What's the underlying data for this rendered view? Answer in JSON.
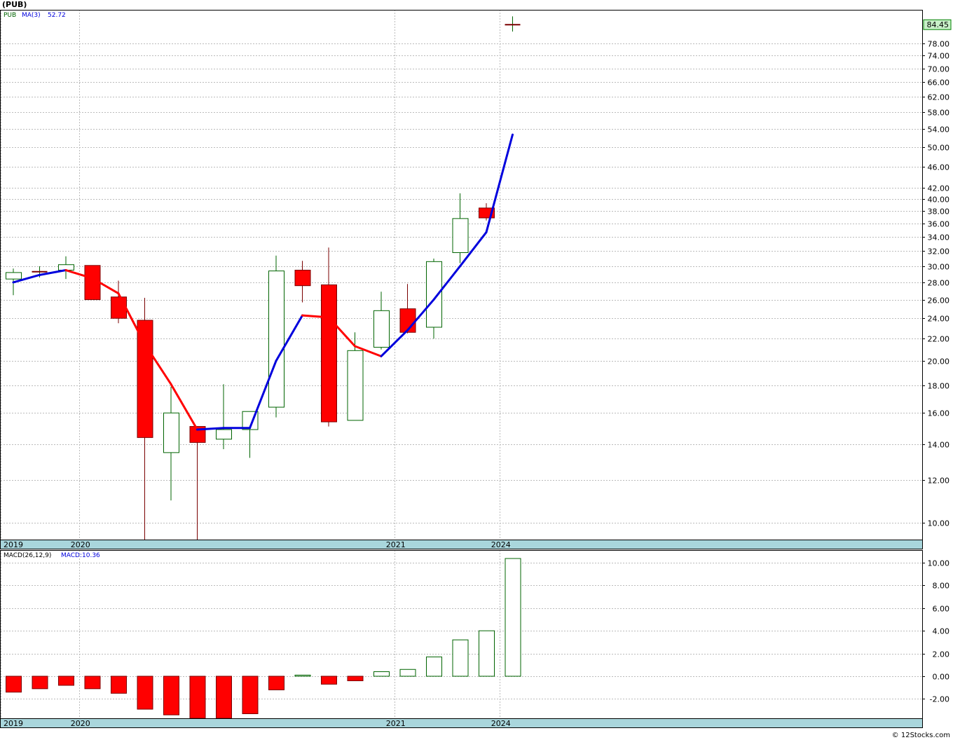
{
  "header": {
    "symbol": "(PUB)",
    "legend_symbol": "PUB",
    "ma_label": "MA(3)",
    "ma_value": "52.72",
    "macd_label": "MACD(26,12,9)",
    "macd_value_label": "MACD:10.36"
  },
  "footer": {
    "watermark": "© 12Stocks.com"
  },
  "colors": {
    "up": "#006400",
    "down": "#ff0000",
    "ma_up": "#0000dd",
    "ma_down": "#ff0000",
    "axis_band": "#a9d6dc",
    "price_tag": "#c8f0c8",
    "grid": "#bbbbbb"
  },
  "chart_data": [
    {
      "type": "candlestick",
      "scale": "log",
      "ylim": [
        9.3,
        90
      ],
      "y_ticks": [
        "78.00",
        "74.00",
        "70.00",
        "66.00",
        "62.00",
        "58.00",
        "54.00",
        "50.00",
        "46.00",
        "42.00",
        "40.00",
        "38.00",
        "36.00",
        "34.00",
        "32.00",
        "30.00",
        "28.00",
        "26.00",
        "24.00",
        "22.00",
        "20.00",
        "18.00",
        "16.00",
        "14.00",
        "12.00",
        "10.00"
      ],
      "last_price_tag": "84.45",
      "x_labels": [
        {
          "label": "2019",
          "index": 0
        },
        {
          "label": "2020",
          "index": 3
        },
        {
          "label": "2021",
          "index": 15
        },
        {
          "label": "2024",
          "index": 19
        }
      ],
      "candles": [
        {
          "o": 28.4,
          "h": 29.7,
          "l": 26.5,
          "c": 29.2
        },
        {
          "o": 29.3,
          "h": 30.0,
          "l": 28.6,
          "c": 29.3
        },
        {
          "o": 29.5,
          "h": 31.3,
          "l": 28.4,
          "c": 30.2
        },
        {
          "o": 30.1,
          "h": 30.1,
          "l": 26.0,
          "c": 26.0
        },
        {
          "o": 26.3,
          "h": 28.2,
          "l": 23.5,
          "c": 24.0
        },
        {
          "o": 23.8,
          "h": 26.2,
          "l": 9.3,
          "c": 14.4
        },
        {
          "o": 13.5,
          "h": 17.9,
          "l": 11.0,
          "c": 16.0
        },
        {
          "o": 15.1,
          "h": 15.1,
          "l": 9.3,
          "c": 14.1
        },
        {
          "o": 14.3,
          "h": 18.1,
          "l": 13.7,
          "c": 14.9
        },
        {
          "o": 14.9,
          "h": 16.1,
          "l": 13.2,
          "c": 16.1
        },
        {
          "o": 16.4,
          "h": 31.4,
          "l": 15.7,
          "c": 29.4
        },
        {
          "o": 29.5,
          "h": 30.7,
          "l": 25.7,
          "c": 27.6
        },
        {
          "o": 27.7,
          "h": 32.5,
          "l": 15.1,
          "c": 15.4
        },
        {
          "o": 15.5,
          "h": 22.6,
          "l": 15.5,
          "c": 20.9
        },
        {
          "o": 21.2,
          "h": 26.9,
          "l": 21.0,
          "c": 24.8
        },
        {
          "o": 25.0,
          "h": 27.8,
          "l": 22.5,
          "c": 22.6
        },
        {
          "o": 23.1,
          "h": 31.0,
          "l": 22.0,
          "c": 30.6
        },
        {
          "o": 31.8,
          "h": 41.0,
          "l": 30.4,
          "c": 36.8
        },
        {
          "o": 38.5,
          "h": 39.3,
          "l": 36.5,
          "c": 36.9
        },
        {
          "o": 84.45,
          "h": 87.5,
          "l": 82.0,
          "c": 84.45
        }
      ],
      "ma3": [
        28.0,
        28.9,
        29.5,
        28.5,
        26.7,
        21.5,
        18.1,
        14.9,
        15.0,
        15.0,
        20.0,
        24.3,
        24.1,
        21.3,
        20.4,
        22.8,
        26.0,
        30.0,
        34.7,
        52.72
      ]
    },
    {
      "type": "bar",
      "title": "MACD(26,12,9)",
      "ylim": [
        -3.7,
        11.1
      ],
      "y_ticks": [
        "10.00",
        "8.00",
        "6.00",
        "4.00",
        "2.00",
        "0.00",
        "-2.00"
      ],
      "x_labels": [
        {
          "label": "2019",
          "index": 0
        },
        {
          "label": "2020",
          "index": 3
        },
        {
          "label": "2021",
          "index": 15
        },
        {
          "label": "2024",
          "index": 19
        }
      ],
      "values": [
        -1.4,
        -1.1,
        -0.8,
        -1.1,
        -1.5,
        -2.9,
        -3.4,
        -3.7,
        -3.7,
        -3.3,
        -1.2,
        0.1,
        -0.7,
        -0.4,
        0.4,
        0.6,
        1.7,
        3.2,
        4.0,
        10.36
      ]
    }
  ]
}
